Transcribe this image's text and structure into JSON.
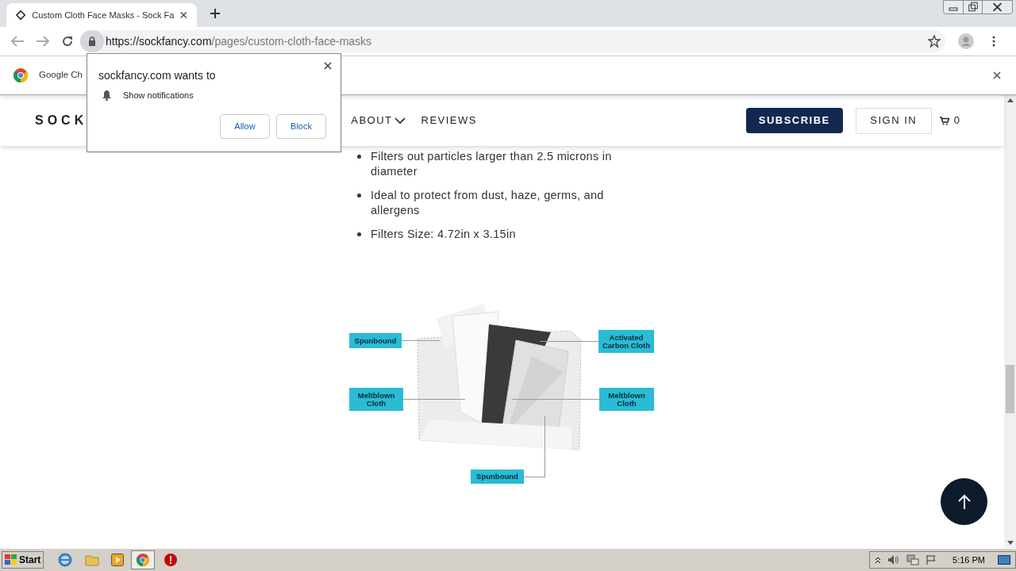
{
  "tabs": [
    {
      "title": "Custom Cloth Face Masks - Sock Fa",
      "selected": true
    }
  ],
  "address_bar": {
    "host": "https://sockfancy.com",
    "path": "/pages/custom-cloth-face-masks"
  },
  "info_bar": {
    "text": "Google Ch"
  },
  "permission_popup": {
    "title": "sockfancy.com wants to",
    "permission": "Show notifications",
    "buttons": [
      "Allow",
      "Block"
    ]
  },
  "site_header": {
    "logo": "SOCK",
    "nav": [
      {
        "label": "ABOUT",
        "dropdown": true
      },
      {
        "label": "REVIEWS",
        "dropdown": false
      }
    ],
    "subscribe": "SUBSCRIBE",
    "sign_in": "SIGN IN",
    "cart_count": "0"
  },
  "features": [
    "Filters out particles larger than 2.5 microns in diameter",
    "Ideal to protect from dust, haze, germs, and allergens",
    "Filters Size: 4.72in x 3.15in"
  ],
  "diagram_labels": [
    "Spunbound",
    "Activated Carbon Cloth",
    "Meltblown Cloth",
    "Meltblown Cloth",
    "Spunbound"
  ],
  "taskbar": {
    "start": "Start",
    "clock": "5:16 PM"
  }
}
